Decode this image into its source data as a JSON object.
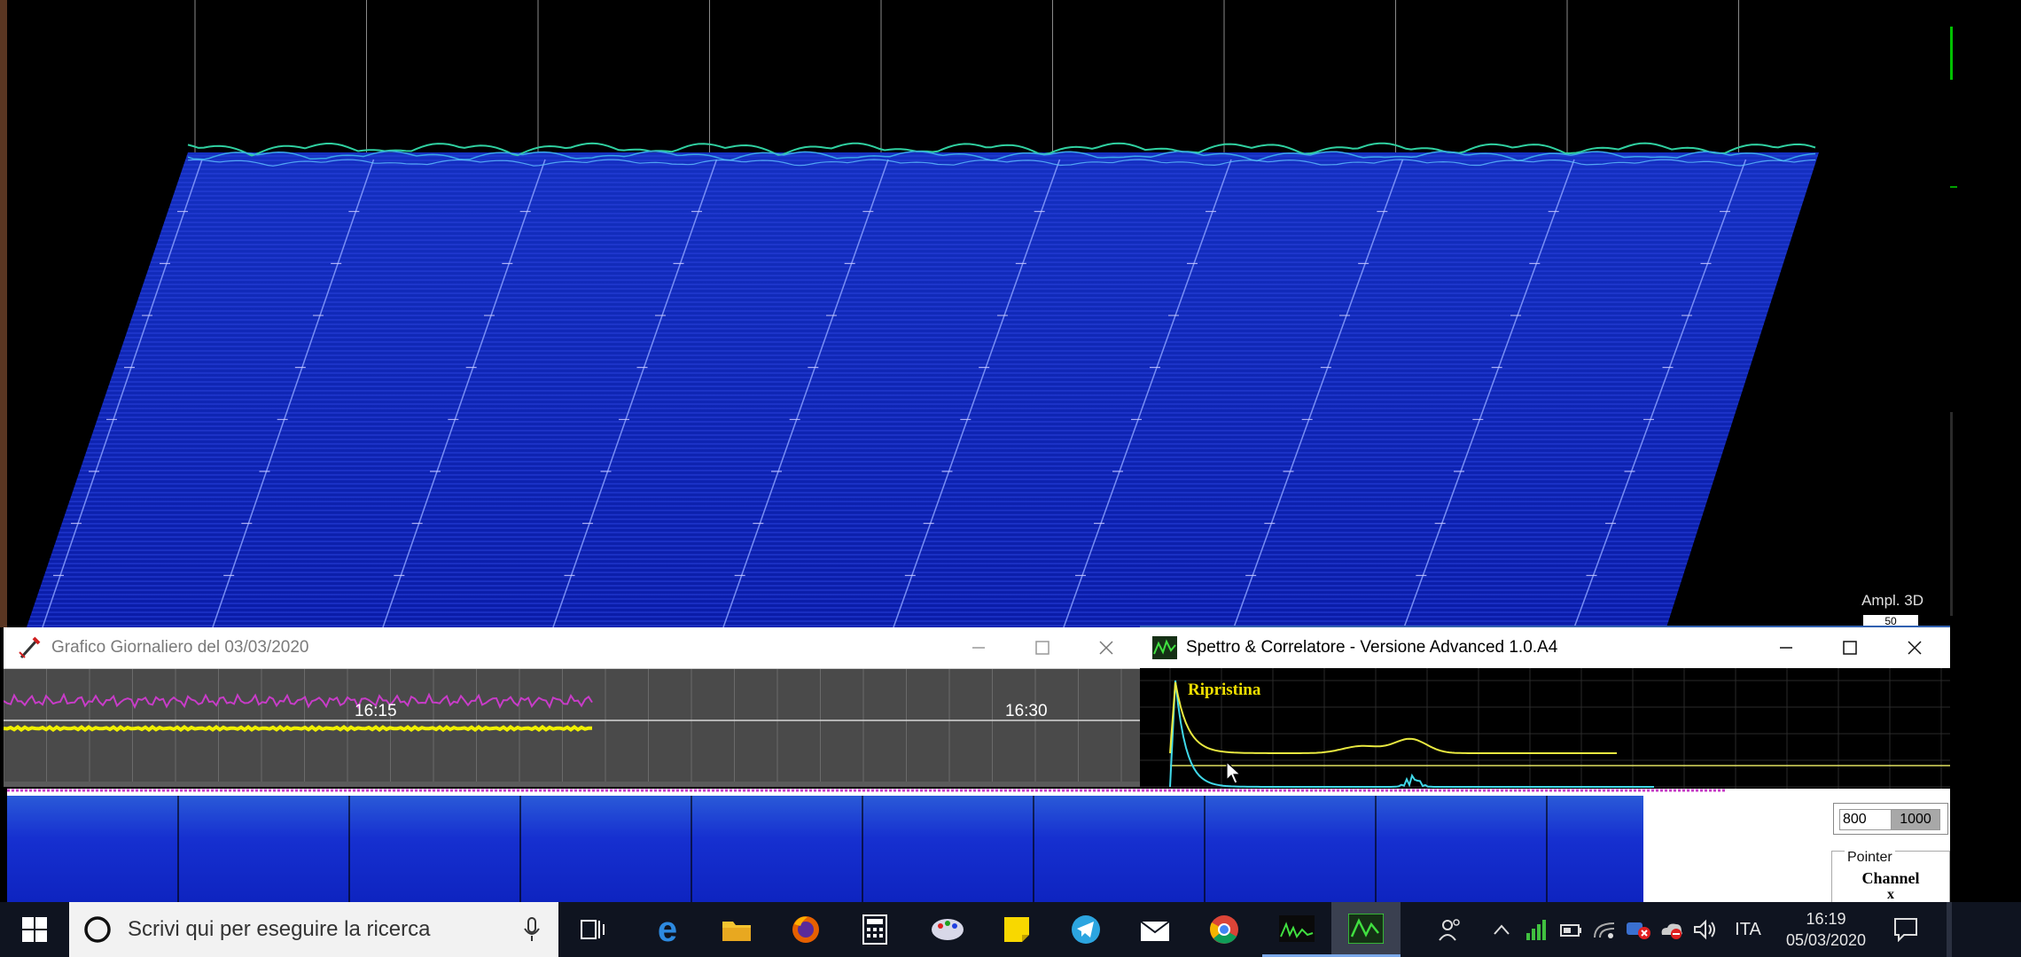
{
  "plot3d": {
    "ampl_label": "Ampl. 3D",
    "ampl_value": "50"
  },
  "grafico": {
    "title": "Grafico Giornaliero del 03/03/2020",
    "time_labels": [
      "16:15",
      "16:30"
    ]
  },
  "spettro": {
    "title": "Spettro & Correlatore - Versione Advanced 1.0.A4",
    "ripristina": "Ripristina"
  },
  "controls": {
    "range_min": "800",
    "range_max": "1000",
    "pointer_group": "Pointer",
    "channel_label": "Channel",
    "channel_value": "x"
  },
  "taskbar": {
    "search_placeholder": "Scrivi qui per eseguire la ricerca",
    "language": "ITA",
    "time": "16:19",
    "date": "05/03/2020"
  },
  "colors": {
    "spectrogram_blue": "#1428c8",
    "trace_magenta": "#c83cc8",
    "trace_yellow": "#f0f000",
    "taskbar": "#0f1420"
  }
}
